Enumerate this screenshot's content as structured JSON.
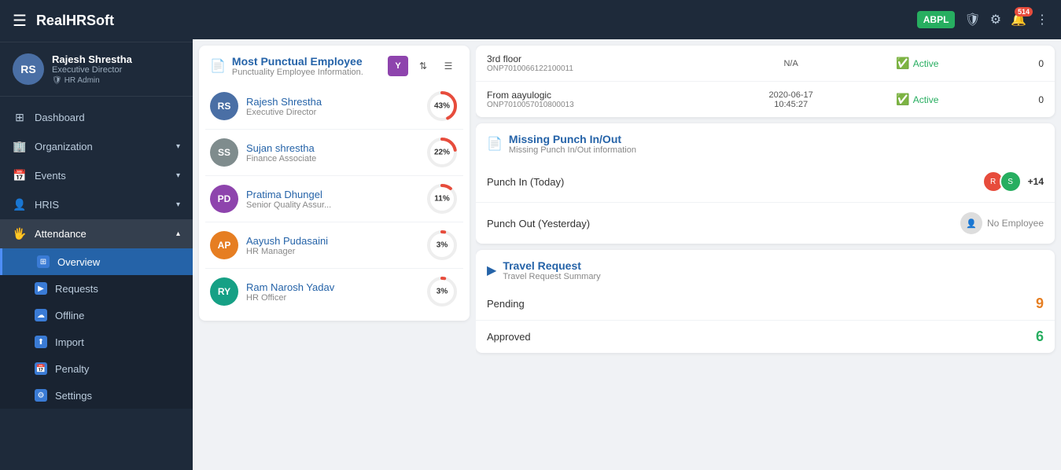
{
  "app": {
    "title": "RealHRSoft",
    "topbar": {
      "avatar_label": "ABPL",
      "notification_count": "514"
    }
  },
  "user": {
    "name": "Rajesh Shrestha",
    "role": "Executive Director",
    "badge": "HR Admin",
    "initials": "RS"
  },
  "nav": {
    "items": [
      {
        "label": "Dashboard",
        "icon": "⊞",
        "active": false,
        "has_sub": false
      },
      {
        "label": "Organization",
        "icon": "🏢",
        "active": false,
        "has_sub": true
      },
      {
        "label": "Events",
        "icon": "📅",
        "active": false,
        "has_sub": true
      },
      {
        "label": "HRIS",
        "icon": "👤",
        "active": false,
        "has_sub": true
      },
      {
        "label": "Attendance",
        "icon": "🖐",
        "active": true,
        "has_sub": true
      }
    ],
    "sub_items": [
      {
        "label": "Overview",
        "active": true
      },
      {
        "label": "Requests",
        "active": false
      },
      {
        "label": "Offline",
        "active": false
      },
      {
        "label": "Import",
        "active": false
      },
      {
        "label": "Penalty",
        "active": false
      },
      {
        "label": "Settings",
        "active": false
      }
    ]
  },
  "top_table": {
    "rows": [
      {
        "name": "3rd floor",
        "id": "ONP7010066122100011",
        "date": "N/A",
        "status": "Active",
        "count": "0"
      },
      {
        "name": "From aayulogic",
        "id": "ONP7010057010800013",
        "date": "2020-06-17\n10:45:27",
        "status": "Active",
        "count": "0"
      }
    ]
  },
  "most_punctual": {
    "title": "Most Punctual Employee",
    "subtitle": "Punctuality Employee Information.",
    "btn_label": "Y",
    "employees": [
      {
        "name": "Rajesh Shrestha",
        "role": "Executive Director",
        "percent": 43,
        "color": "#e74c3c",
        "initials": "RS"
      },
      {
        "name": "Sujan shrestha",
        "role": "Finance Associate",
        "percent": 22,
        "color": "#e74c3c",
        "initials": "SS"
      },
      {
        "name": "Pratima Dhungel",
        "role": "Senior Quality Assur...",
        "percent": 11,
        "color": "#e74c3c",
        "initials": "PD"
      },
      {
        "name": "Aayush Pudasaini",
        "role": "HR Manager",
        "percent": 3,
        "color": "#e74c3c",
        "initials": "AP"
      },
      {
        "name": "Ram Narosh Yadav",
        "role": "HR Officer",
        "percent": 3,
        "color": "#e74c3c",
        "initials": "RY"
      }
    ]
  },
  "missing_punch": {
    "title": "Missing Punch In/Out",
    "subtitle": "Missing Punch In/Out information",
    "punch_in_label": "Punch In (Today)",
    "punch_in_more": "+14",
    "punch_out_label": "Punch Out (Yesterday)",
    "punch_out_no_emp": "No Employee"
  },
  "travel_request": {
    "title": "Travel Request",
    "subtitle": "Travel Request Summary",
    "pending_label": "Pending",
    "pending_count": "9",
    "approved_label": "Approved",
    "approved_count": "6"
  }
}
